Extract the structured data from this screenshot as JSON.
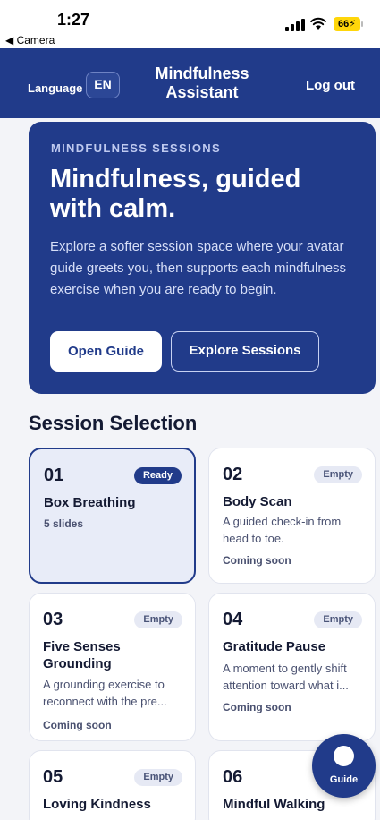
{
  "status_bar": {
    "time": "1:27",
    "back_label": "◀ Camera",
    "battery": "66⚡"
  },
  "header": {
    "language_label": "Language",
    "language_code": "EN",
    "title": "Mindfulness Assistant",
    "logout_label": "Log out"
  },
  "hero": {
    "eyebrow": "MINDFULNESS SESSIONS",
    "title": "Mindfulness, guided with calm.",
    "description": "Explore a softer session space where your avatar guide greets you, then supports each mindfulness exercise when you are ready to begin.",
    "primary_button": "Open Guide",
    "secondary_button": "Explore Sessions"
  },
  "section_title": "Session Selection",
  "sessions": [
    {
      "number": "01",
      "badge": "Ready",
      "title": "Box Breathing",
      "description": "",
      "meta": "5 slides"
    },
    {
      "number": "02",
      "badge": "Empty",
      "title": "Body Scan",
      "description": "A guided check-in from head to toe.",
      "meta": "Coming soon"
    },
    {
      "number": "03",
      "badge": "Empty",
      "title": "Five Senses Grounding",
      "description": "A grounding exercise to reconnect with the pre...",
      "meta": "Coming soon"
    },
    {
      "number": "04",
      "badge": "Empty",
      "title": "Gratitude Pause",
      "description": "A moment to gently shift attention toward what i...",
      "meta": "Coming soon"
    },
    {
      "number": "05",
      "badge": "Empty",
      "title": "Loving Kindness",
      "description": "",
      "meta": ""
    },
    {
      "number": "06",
      "badge": "",
      "title": "Mindful Walking",
      "description": "",
      "meta": ""
    }
  ],
  "fab": {
    "label": "Guide"
  },
  "colors": {
    "primary": "#213b8a",
    "background": "#f3f4f8",
    "badge_empty": "#e6e9f4"
  }
}
